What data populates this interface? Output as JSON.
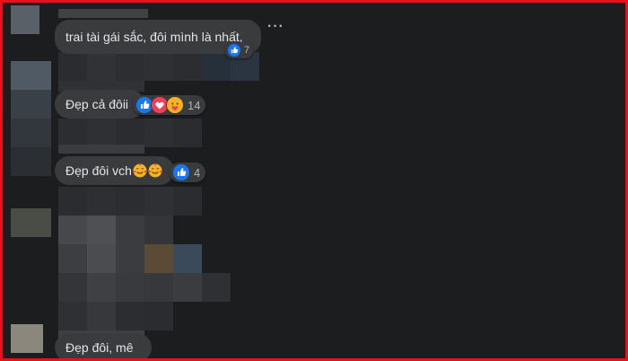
{
  "comments": [
    {
      "text": "trai tài gái sắc, đôi mình là nhất,",
      "reaction_count": "7",
      "reactions": [
        "like"
      ]
    },
    {
      "text": "Đẹp cả đôii",
      "reaction_count": "14",
      "reactions": [
        "like",
        "love",
        "care"
      ]
    },
    {
      "text": "Đẹp đôi vch",
      "reaction_count": "4",
      "reactions": [
        "like"
      ]
    },
    {
      "text": "Đẹp đôi, mê",
      "reaction_count": "",
      "reactions": []
    }
  ],
  "more_options_label": "···",
  "colors": {
    "frame_border": "#e8111b",
    "background": "#1c1d1f",
    "bubble": "#3a3b3c",
    "text": "#e4e6eb",
    "like": "#1877f2",
    "love": "#f33e58",
    "care": "#f7b125"
  }
}
